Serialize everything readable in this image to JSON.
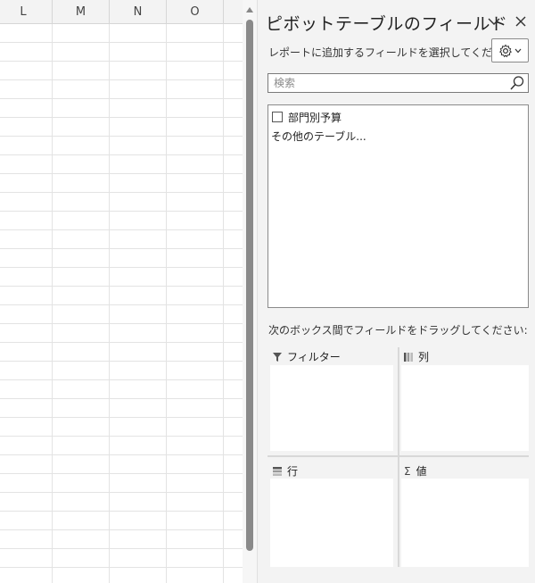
{
  "sheet": {
    "columns": [
      "L",
      "M",
      "N",
      "O"
    ]
  },
  "pane": {
    "title": "ピボットテーブルのフィールド",
    "choose_fields_label": "レポートに追加するフィールドを選択してください:",
    "search": {
      "placeholder": "検索",
      "value": ""
    },
    "fields": [
      {
        "label": "部門別予算",
        "checked": false
      }
    ],
    "more_tables_link": "その他のテーブル...",
    "drag_instruction": "次のボックス間でフィールドをドラッグしてください:",
    "areas": {
      "filters": "フィルター",
      "columns": "列",
      "rows": "行",
      "values": "値"
    }
  },
  "icons": {
    "collapse": "chevron-down-icon",
    "close": "close-icon",
    "settings": "gear-icon",
    "search": "search-icon",
    "filters": "filter-icon",
    "columns": "columns-icon",
    "rows": "rows-icon",
    "values": "sigma-icon"
  },
  "colors": {
    "pane_background": "#f3f3f3",
    "sheet_background": "#ffffff",
    "gridline": "#e3e3e3",
    "scroll_thumb": "#8a8a8a"
  }
}
